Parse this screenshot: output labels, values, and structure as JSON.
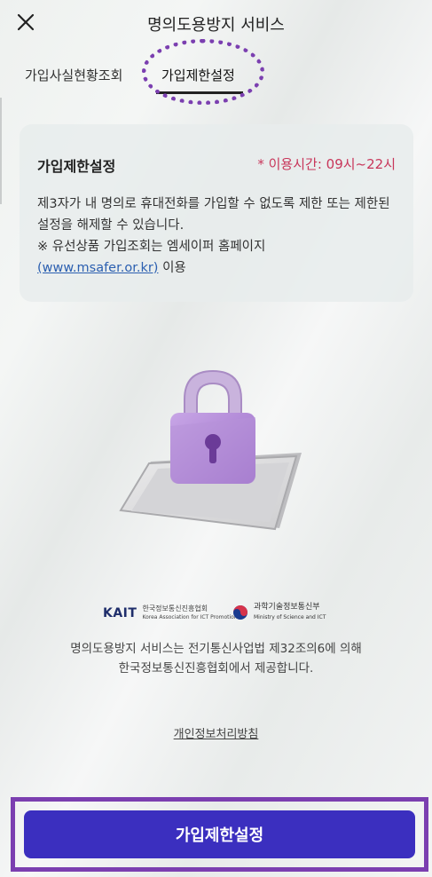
{
  "header": {
    "title": "명의도용방지 서비스",
    "close_icon": "close-icon"
  },
  "tabs": [
    {
      "label": "가입사실현황조회",
      "active": false
    },
    {
      "label": "가입제한설정",
      "active": true
    }
  ],
  "card": {
    "title": "가입제한설정",
    "hours": "* 이용시간: 09시~22시",
    "desc_line1": "제3자가 내 명의로 휴대전화를 가입할 수 없도록 제한 또는 제한된 설정을 해제할 수 있습니다.",
    "note_prefix": "※ 유선상품 가입조회는 엠세이퍼 홈페이지",
    "note_link": "(www.msafer.or.kr)",
    "note_suffix": " 이용"
  },
  "logos": {
    "kait_mark": "KAIT",
    "kait_name": "한국정보통신진흥협회",
    "kait_sub": "Korea Association for ICT Promotion",
    "msit_name": "과학기술정보통신부",
    "msit_sub": "Ministry of Science and ICT"
  },
  "footer": {
    "line1": "명의도용방지 서비스는 전기통신사업법 제32조의6에 의해",
    "line2": "한국정보통신진흥협회에서 제공합니다.",
    "privacy": "개인정보처리방침"
  },
  "cta": {
    "label": "가입제한설정"
  },
  "colors": {
    "accent": "#3b2fbf",
    "highlight": "#7b3fb0",
    "hours": "#c8365a",
    "link": "#2b5fb0"
  }
}
